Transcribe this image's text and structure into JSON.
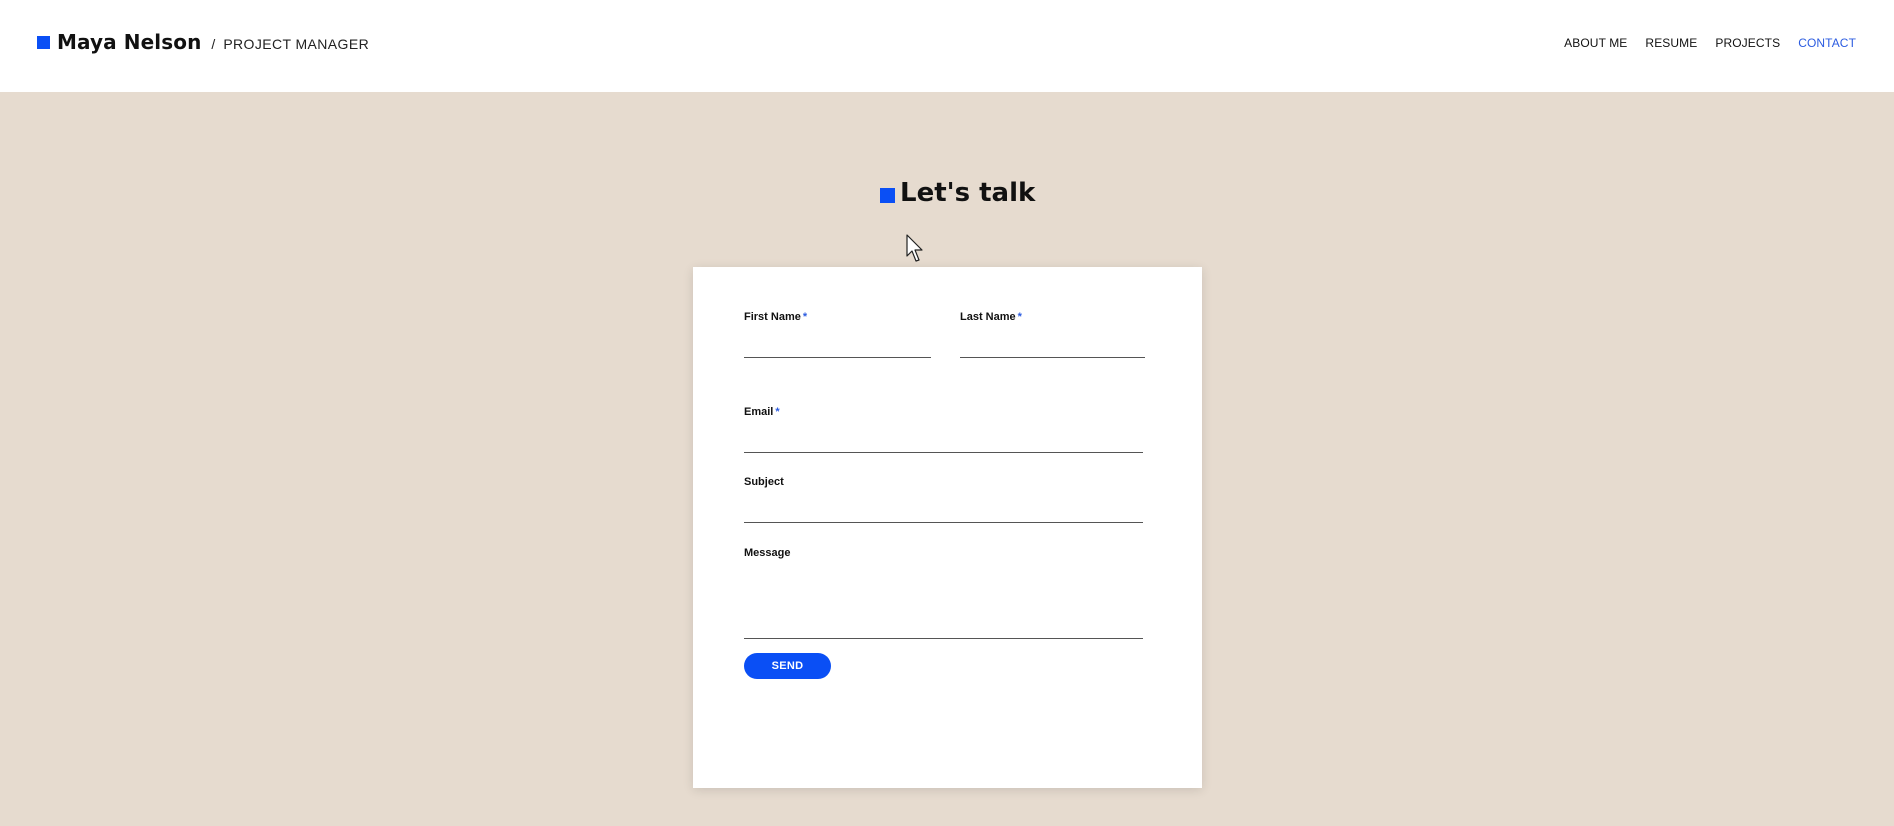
{
  "header": {
    "brand_name": "Maya Nelson",
    "brand_separator": "/",
    "brand_role": "PROJECT MANAGER",
    "nav": [
      {
        "label": "ABOUT ME",
        "active": false
      },
      {
        "label": "RESUME",
        "active": false
      },
      {
        "label": "PROJECTS",
        "active": false
      },
      {
        "label": "CONTACT",
        "active": true
      }
    ]
  },
  "section": {
    "title": "Let's talk"
  },
  "form": {
    "first_name": {
      "label": "First Name",
      "required_mark": "*",
      "value": ""
    },
    "last_name": {
      "label": "Last Name",
      "required_mark": "*",
      "value": ""
    },
    "email": {
      "label": "Email",
      "required_mark": "*",
      "value": ""
    },
    "subject": {
      "label": "Subject",
      "value": ""
    },
    "message": {
      "label": "Message",
      "value": ""
    },
    "send_label": "SEND"
  },
  "colors": {
    "accent": "#0a4ff5",
    "background": "#e6dbcf",
    "nav_active": "#2c5ce0"
  },
  "icons": {
    "cursor": "mouse-pointer-icon"
  }
}
